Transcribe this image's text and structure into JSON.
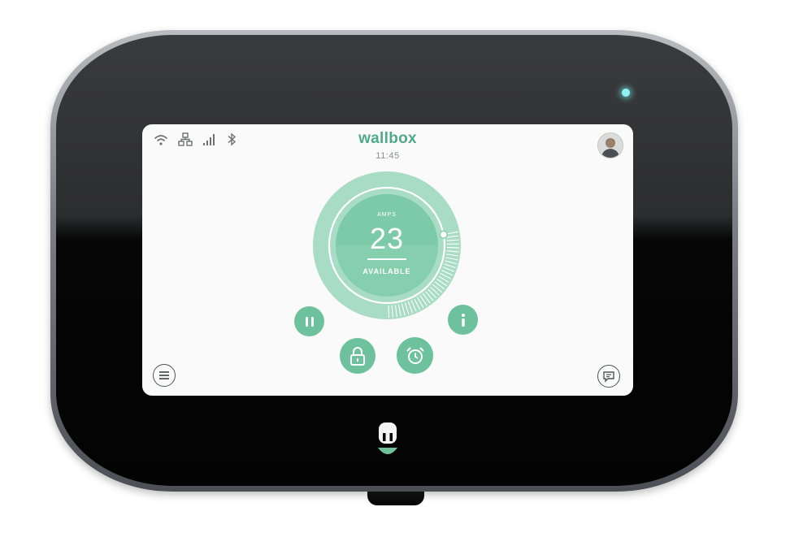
{
  "header": {
    "title": "wallbox",
    "time": "11:45"
  },
  "status_icons": [
    "wifi-icon",
    "ethernet-icon",
    "cellular-signal-icon",
    "bluetooth-icon"
  ],
  "dial": {
    "unit_label": "AMPS",
    "value": "23",
    "status": "AVAILABLE",
    "level_fraction": 0.72
  },
  "controls": {
    "pause": "pause-icon",
    "info": "info-icon",
    "lock": "lock-icon",
    "schedule": "alarm-clock-icon",
    "menu": "menu-icon",
    "messages": "chat-icon"
  },
  "colors": {
    "accent": "#6dc29d",
    "accent_light": "#a8dcc4",
    "brand": "#4fa989",
    "led": "#8ef3f0",
    "screen_bg": "#f9faf9"
  }
}
